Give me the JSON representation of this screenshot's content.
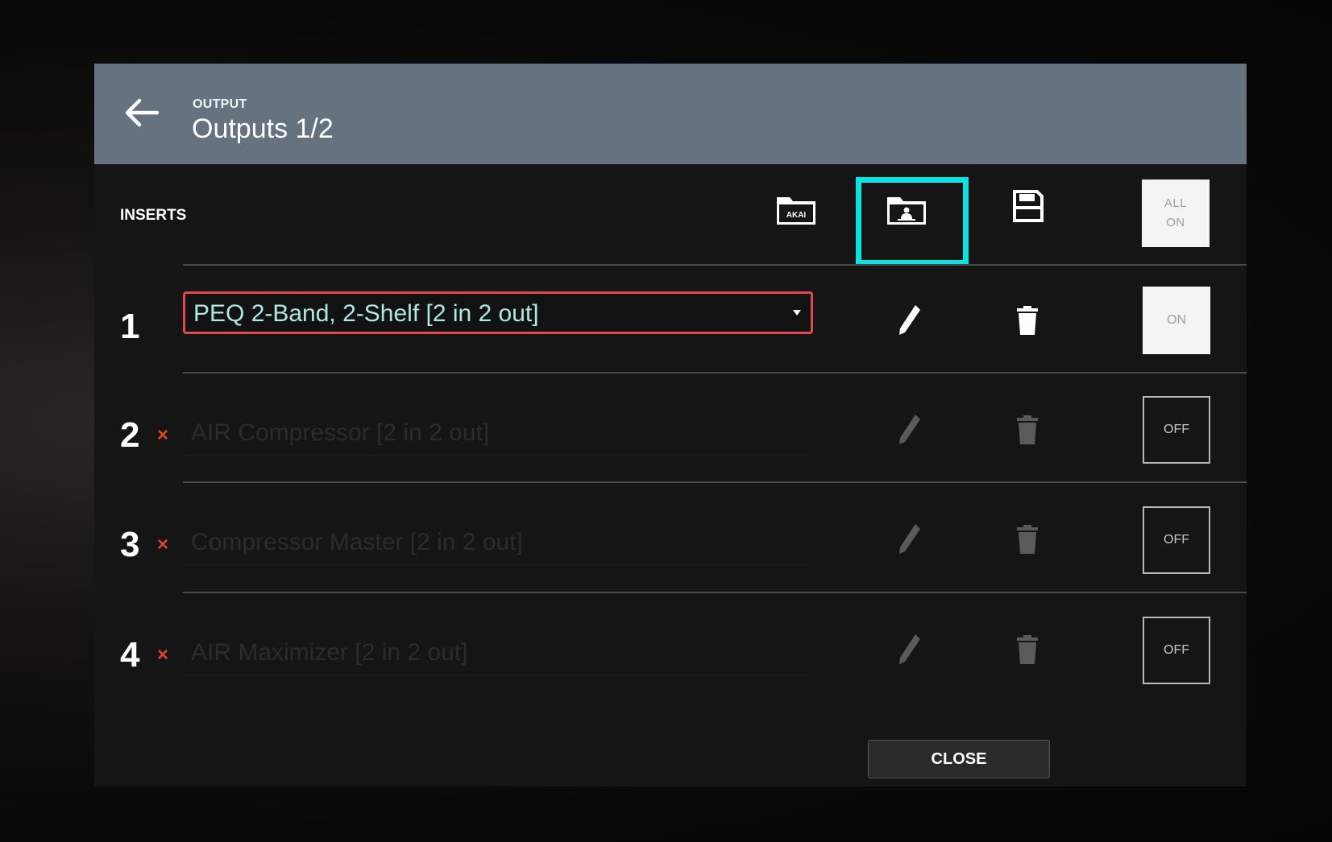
{
  "header": {
    "subtitle": "OUTPUT",
    "title": "Outputs 1/2"
  },
  "toolbar": {
    "section_label": "INSERTS",
    "akai_folder_text": "AKAI",
    "all_on_line1": "ALL",
    "all_on_line2": "ON"
  },
  "inserts": [
    {
      "number": "1",
      "plugin": "PEQ 2-Band, 2-Shelf [2 in 2 out]",
      "state": "ON",
      "active": true
    },
    {
      "number": "2",
      "marker": "×",
      "plugin": "AIR Compressor [2 in 2 out]",
      "state": "OFF",
      "active": false
    },
    {
      "number": "3",
      "marker": "×",
      "plugin": "Compressor Master [2 in 2 out]",
      "state": "OFF",
      "active": false
    },
    {
      "number": "4",
      "marker": "×",
      "plugin": "AIR Maximizer [2 in 2 out]",
      "state": "OFF",
      "active": false
    }
  ],
  "footer": {
    "close_label": "CLOSE"
  },
  "colors": {
    "header_bg": "#677280",
    "highlight": "#0be3e3",
    "select_border": "#e04a4a",
    "select_text": "#aee8e2",
    "disabled_marker": "#e0452a"
  }
}
